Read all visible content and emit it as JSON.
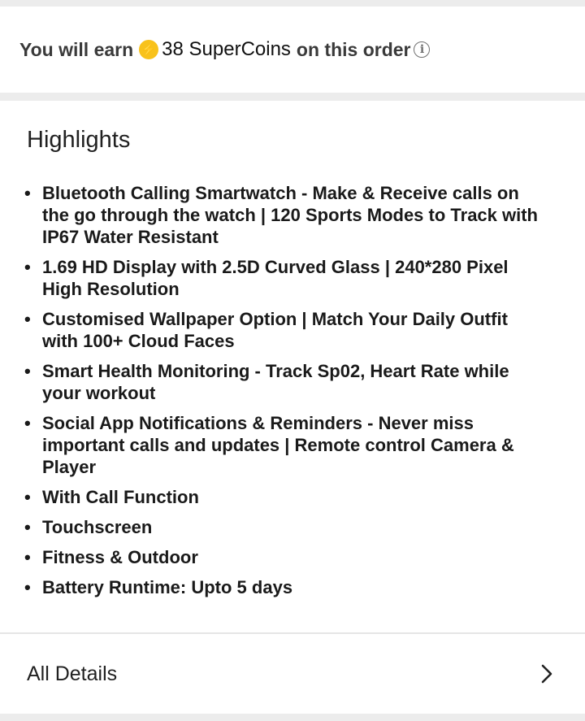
{
  "supercoins": {
    "prefix": "You will earn",
    "amount": "38 SuperCoins",
    "suffix": "on this order",
    "coin_icon": "lightning-coin-icon",
    "info_icon": "info-icon",
    "coin_color": "#f8c21b"
  },
  "highlights": {
    "title": "Highlights",
    "items": [
      "Bluetooth Calling Smartwatch - Make & Receive calls on the go through the watch | 120 Sports Modes to Track with IP67 Water Resistant",
      "1.69 HD Display with 2.5D Curved Glass | 240*280 Pixel High Resolution",
      "Customised Wallpaper Option | Match Your Daily Outfit with 100+ Cloud Faces",
      "Smart Health Monitoring - Track Sp02, Heart Rate while your workout",
      "Social App Notifications & Reminders - Never miss important calls and updates | Remote control Camera & Player",
      "With Call Function",
      "Touchscreen",
      "Fitness & Outdoor",
      "Battery Runtime: Upto 5 days"
    ]
  },
  "all_details": {
    "label": "All Details",
    "icon": "chevron-right-icon"
  }
}
